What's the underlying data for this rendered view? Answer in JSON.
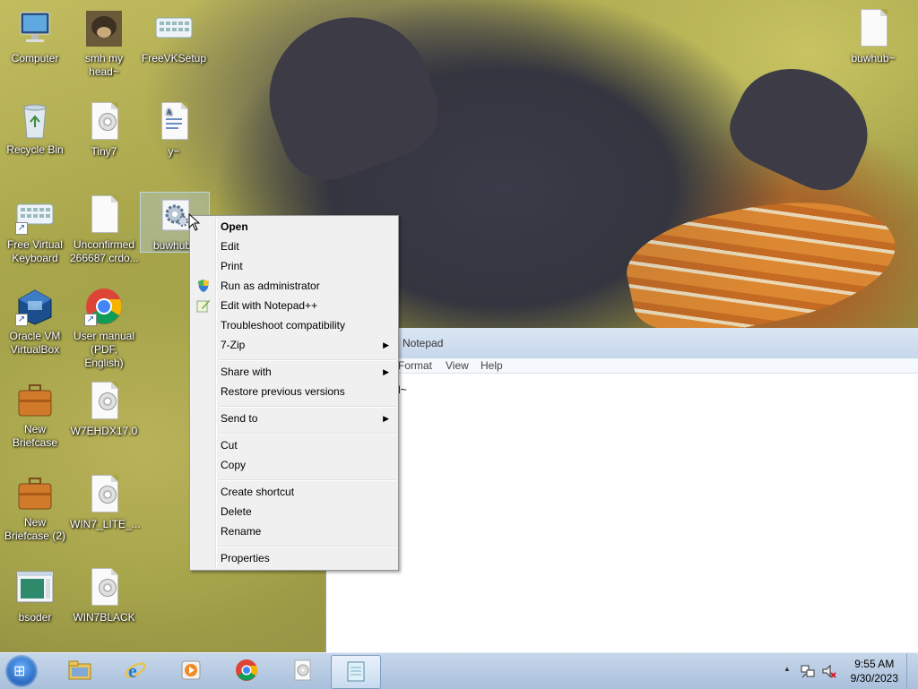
{
  "desktop": {
    "icons": [
      {
        "label": "Computer"
      },
      {
        "label": "smh my head~"
      },
      {
        "label": "FreeVKSetup"
      },
      {
        "label": "buwhub~"
      },
      {
        "label": "Recycle Bin"
      },
      {
        "label": "Tiny7"
      },
      {
        "label": "y~"
      },
      {
        "label": "Free Virtual Keyboard"
      },
      {
        "label": "Unconfirmed 266687.crdo..."
      },
      {
        "label": "buwhub"
      },
      {
        "label": "Oracle VM VirtualBox"
      },
      {
        "label": "User manual (PDF, English)"
      },
      {
        "label": "New Briefcase"
      },
      {
        "label": "W7EHDX17.0"
      },
      {
        "label": "New Briefcase (2)"
      },
      {
        "label": "WIN7_LITE_..."
      },
      {
        "label": "bsoder"
      },
      {
        "label": "WIN7BLACK"
      }
    ]
  },
  "notepad": {
    "title": "Notepad",
    "menu": [
      "Format",
      "View",
      "Help"
    ],
    "content": "l~"
  },
  "context_menu": {
    "items": [
      {
        "label": "Open",
        "bold": true
      },
      {
        "label": "Edit"
      },
      {
        "label": "Print"
      },
      {
        "label": "Run as administrator",
        "icon": "shield-icon"
      },
      {
        "label": "Edit with Notepad++",
        "icon": "notepadpp-icon"
      },
      {
        "label": "Troubleshoot compatibility"
      },
      {
        "label": "7-Zip",
        "submenu": true
      },
      {
        "label": "Share with",
        "submenu": true
      },
      {
        "label": "Restore previous versions"
      },
      {
        "label": "Send to",
        "submenu": true
      },
      {
        "label": "Cut"
      },
      {
        "label": "Copy"
      },
      {
        "label": "Create shortcut"
      },
      {
        "label": "Delete"
      },
      {
        "label": "Rename"
      },
      {
        "label": "Properties"
      }
    ],
    "submenu_glyph": "▶"
  },
  "taskbar": {
    "clock_time": "9:55 AM",
    "clock_date": "9/30/2023",
    "start_glyph": "⊞",
    "tray_arrow": "▲"
  }
}
